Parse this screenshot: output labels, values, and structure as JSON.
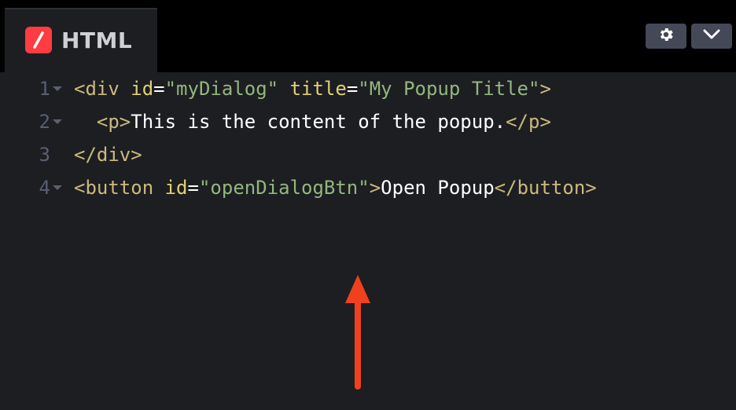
{
  "tab": {
    "label": "HTML",
    "icon": "codepen-slash-icon",
    "accent": "#ff3c41"
  },
  "toolbar": {
    "settings_icon": "gear-icon",
    "collapse_icon": "chevron-down-icon"
  },
  "colors": {
    "background": "#1d1e22",
    "tag": "#cbb97e",
    "attribute": "#e0d075",
    "string": "#93b67e",
    "text": "#ffffff",
    "gutter": "#5a5f73",
    "annotation_arrow": "#f0401e"
  },
  "editor": {
    "lines": [
      {
        "number": "1",
        "tokens": {
          "t0": "<div",
          "sp0": " ",
          "a0": "id",
          "e0": "=",
          "v0": "\"myDialog\"",
          "sp1": " ",
          "a1": "title",
          "e1": "=",
          "v1": "\"My Popup Title\"",
          "t1": ">"
        }
      },
      {
        "number": "2",
        "tokens": {
          "ind": "  ",
          "t0": "<p>",
          "x0": "This is the content of the popup.",
          "t1": "</p>"
        }
      },
      {
        "number": "3",
        "tokens": {
          "t0": "</div>"
        }
      },
      {
        "number": "4",
        "tokens": {
          "t0": "<button",
          "sp0": " ",
          "a0": "id",
          "e0": "=",
          "v0": "\"openDialogBtn\"",
          "t1": ">",
          "x0": "Open Popup",
          "t2": "</button>"
        }
      }
    ]
  },
  "annotation": {
    "icon": "red-up-arrow-icon"
  }
}
